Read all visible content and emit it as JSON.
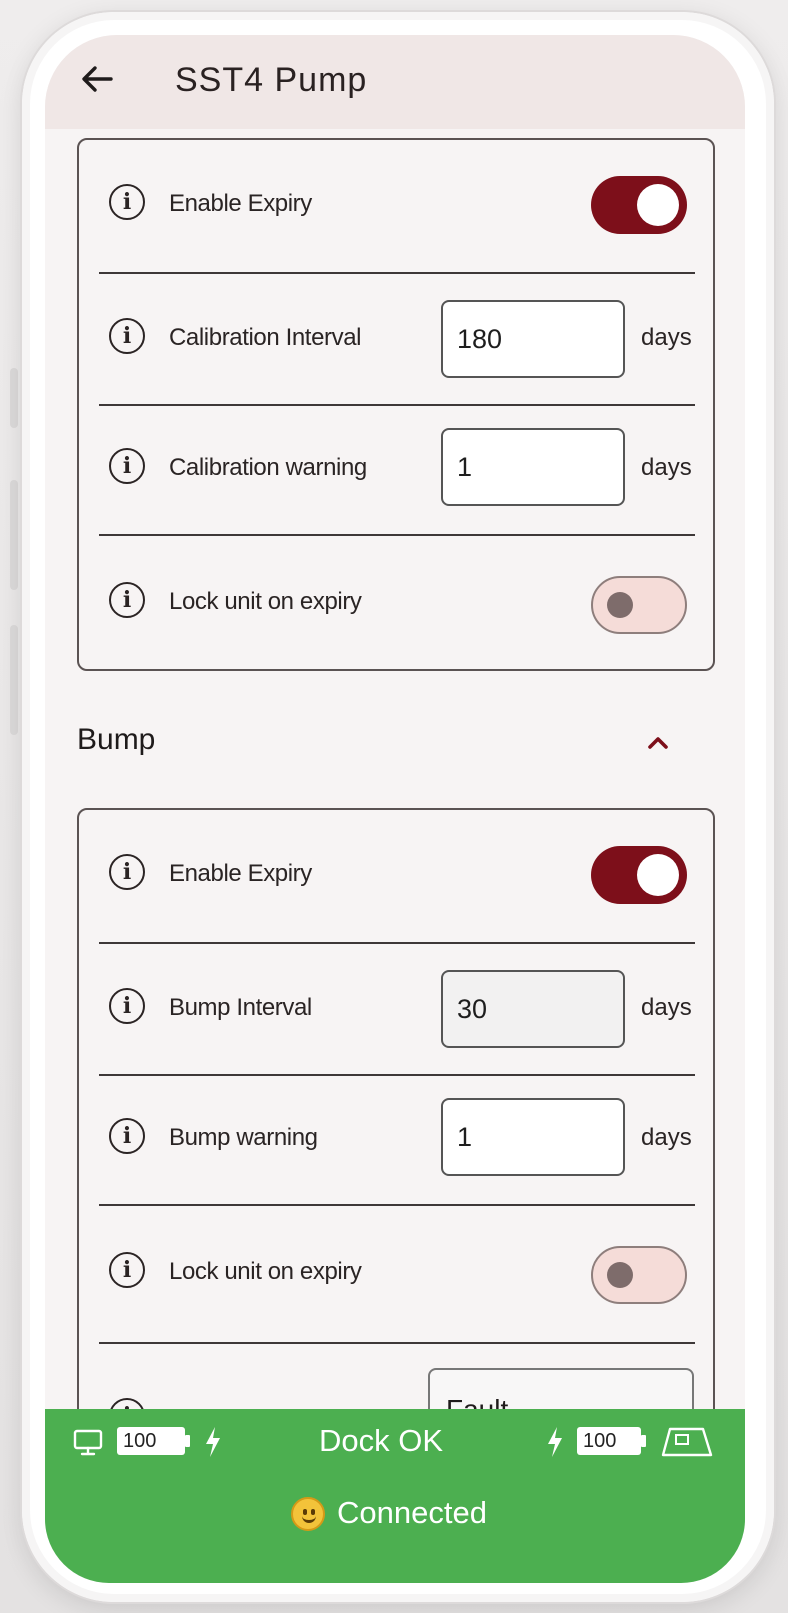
{
  "header": {
    "title": "SST4 Pump",
    "back_icon": "arrow-left-icon"
  },
  "calibration_card": {
    "enable_expiry": {
      "label": "Enable Expiry",
      "on": true
    },
    "interval": {
      "label": "Calibration Interval",
      "value": "180",
      "unit": "days"
    },
    "warning": {
      "label": "Calibration warning",
      "value": "1",
      "unit": "days"
    },
    "lock": {
      "label": "Lock unit on expiry",
      "on": false
    }
  },
  "bump_section": {
    "title": "Bump",
    "expanded": true,
    "enable_expiry": {
      "label": "Enable Expiry",
      "on": true
    },
    "interval": {
      "label": "Bump Interval",
      "value": "30",
      "unit": "days"
    },
    "warning": {
      "label": "Bump warning",
      "value": "1",
      "unit": "days"
    },
    "lock": {
      "label": "Lock unit on expiry",
      "on": false
    },
    "partial_select_value": "Fault"
  },
  "status_bar": {
    "left_battery": "100",
    "dock_status": "Dock OK",
    "right_battery": "100",
    "connection": "Connected",
    "color": "#4caf50"
  },
  "colors": {
    "accent": "#7d0f1a",
    "appbar": "#f0e7e6",
    "toggle_off": "#f5dcd8"
  }
}
